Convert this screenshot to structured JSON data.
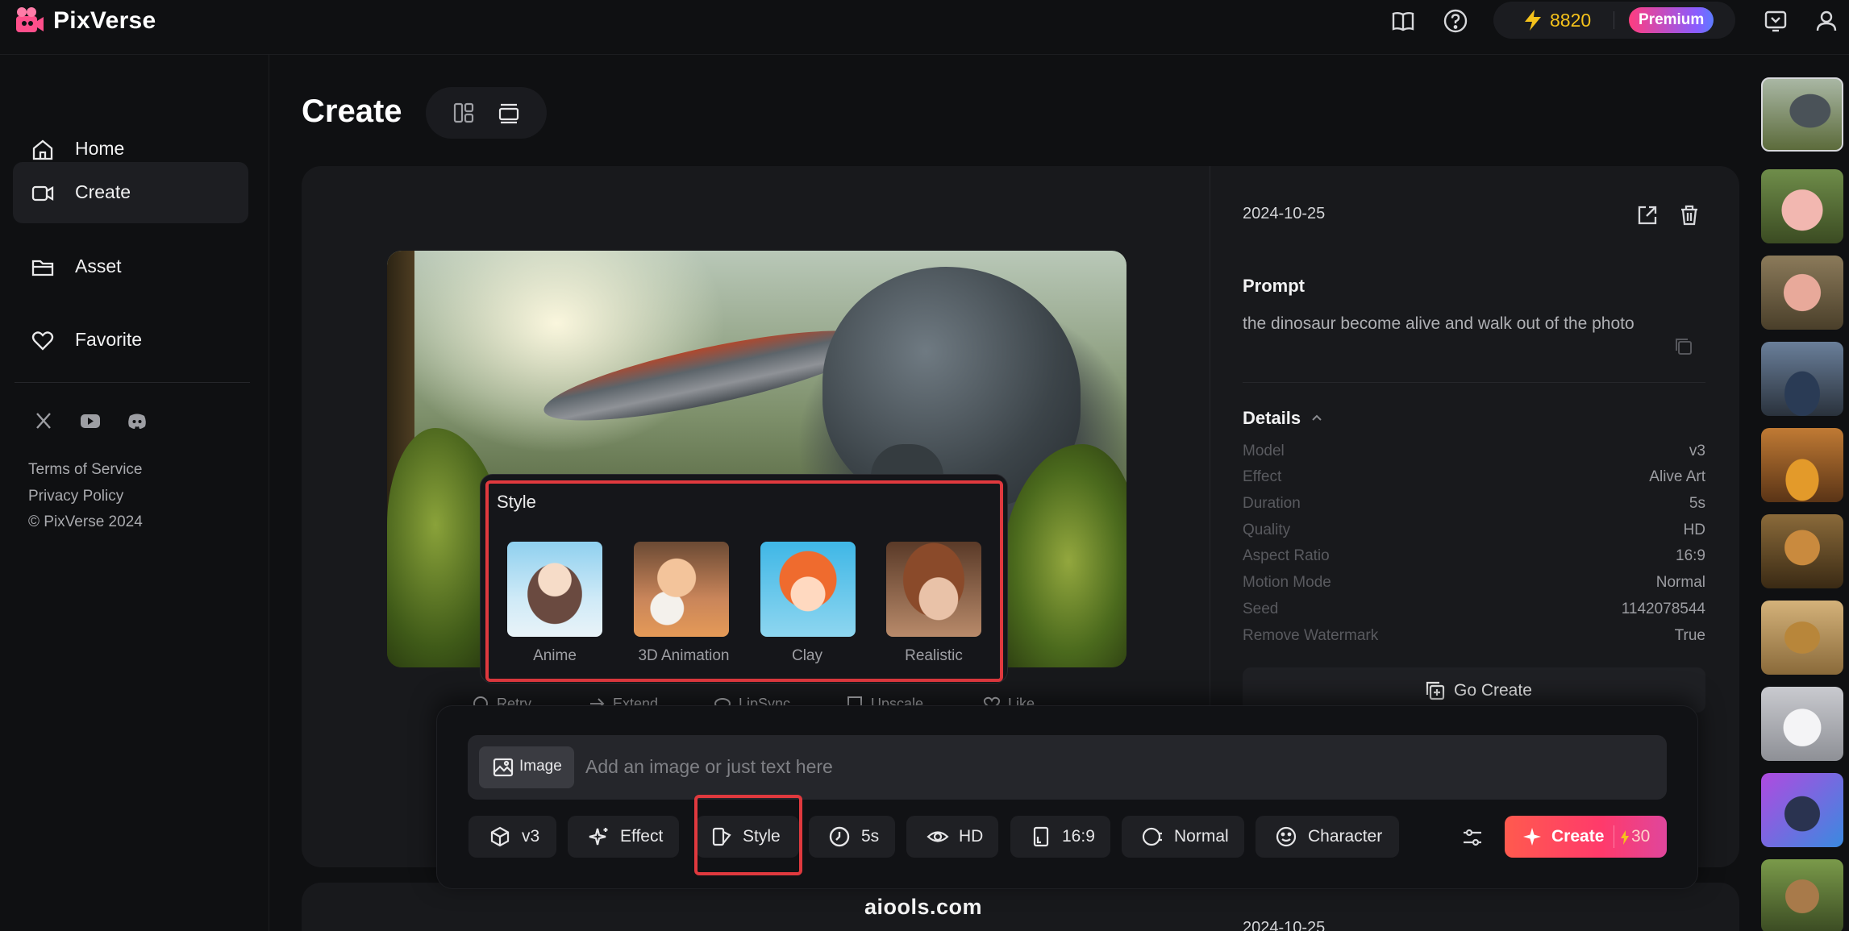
{
  "app": {
    "name": "PixVerse",
    "brand_color": "#ff4f8b"
  },
  "header": {
    "credits": "8820",
    "plan_badge": "Premium",
    "icons": [
      "book-icon",
      "help-icon",
      "bolt-icon",
      "notification-icon",
      "user-icon"
    ]
  },
  "sidebar": {
    "items": [
      {
        "label": "Home",
        "icon": "home-icon"
      },
      {
        "label": "Create",
        "icon": "video-camera-icon",
        "active": true
      },
      {
        "label": "Asset",
        "icon": "folder-icon"
      },
      {
        "label": "Favorite",
        "icon": "heart-icon"
      }
    ],
    "social": [
      "x-icon",
      "youtube-icon",
      "discord-icon"
    ],
    "footer": {
      "terms": "Terms of Service",
      "privacy": "Privacy Policy",
      "copyright": "© PixVerse 2024"
    }
  },
  "main": {
    "title": "Create",
    "video_actions": [
      "Retry",
      "Extend",
      "LipSync",
      "Upscale",
      "Like"
    ]
  },
  "style_popup": {
    "title": "Style",
    "options": [
      {
        "label": "Anime"
      },
      {
        "label": "3D Animation"
      },
      {
        "label": "Clay"
      },
      {
        "label": "Realistic"
      }
    ]
  },
  "details_panel": {
    "date": "2024-10-25",
    "prompt_heading": "Prompt",
    "prompt": "the dinosaur become alive and walk out of the photo",
    "details_heading": "Details",
    "rows": [
      {
        "key": "Model",
        "value": "v3"
      },
      {
        "key": "Effect",
        "value": "Alive Art"
      },
      {
        "key": "Duration",
        "value": "5s"
      },
      {
        "key": "Quality",
        "value": "HD"
      },
      {
        "key": "Aspect Ratio",
        "value": "16:9"
      },
      {
        "key": "Motion Mode",
        "value": "Normal"
      },
      {
        "key": "Seed",
        "value": "1142078544"
      },
      {
        "key": "Remove Watermark",
        "value": "True"
      }
    ],
    "go_create": "Go Create",
    "next_date": "2024-10-25"
  },
  "composer": {
    "image_button": "Image",
    "placeholder": "Add an image or just text here",
    "chips": [
      {
        "label": "v3",
        "icon": "cube-icon"
      },
      {
        "label": "Effect",
        "icon": "sparkle-icon"
      },
      {
        "label": "Style",
        "icon": "style-icon",
        "highlighted": true
      },
      {
        "label": "5s",
        "icon": "clock-icon"
      },
      {
        "label": "HD",
        "icon": "eye-icon"
      },
      {
        "label": "16:9",
        "icon": "aspect-ratio-icon"
      },
      {
        "label": "Normal",
        "icon": "motion-icon"
      },
      {
        "label": "Character",
        "icon": "smiley-icon"
      }
    ],
    "create_label": "Create",
    "create_cost": "30"
  },
  "watermark": "aiools.com"
}
